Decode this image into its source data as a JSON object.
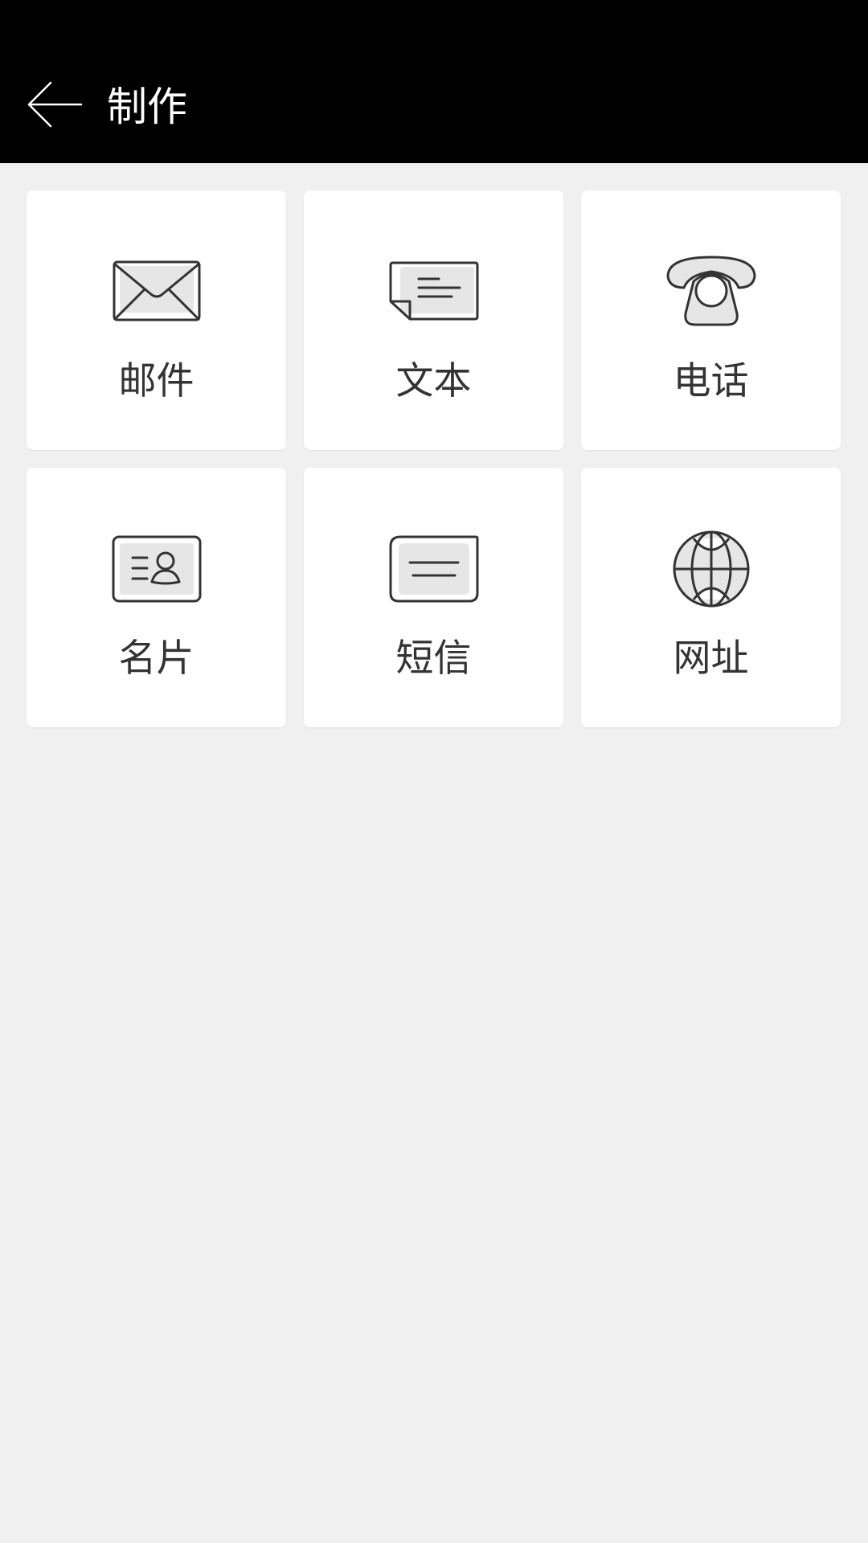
{
  "header": {
    "title": "制作",
    "back_icon": "arrow-left-icon"
  },
  "colors": {
    "header_bg": "#000000",
    "page_bg": "#f0f0f0",
    "tile_bg": "#ffffff",
    "icon_stroke": "#333333",
    "icon_fill": "#e6e6e6",
    "label": "#333333"
  },
  "tiles": [
    {
      "label": "邮件",
      "icon": "envelope-icon"
    },
    {
      "label": "文本",
      "icon": "text-note-icon"
    },
    {
      "label": "电话",
      "icon": "telephone-icon"
    },
    {
      "label": "名片",
      "icon": "business-card-icon"
    },
    {
      "label": "短信",
      "icon": "sms-message-icon"
    },
    {
      "label": "网址",
      "icon": "globe-icon"
    }
  ]
}
